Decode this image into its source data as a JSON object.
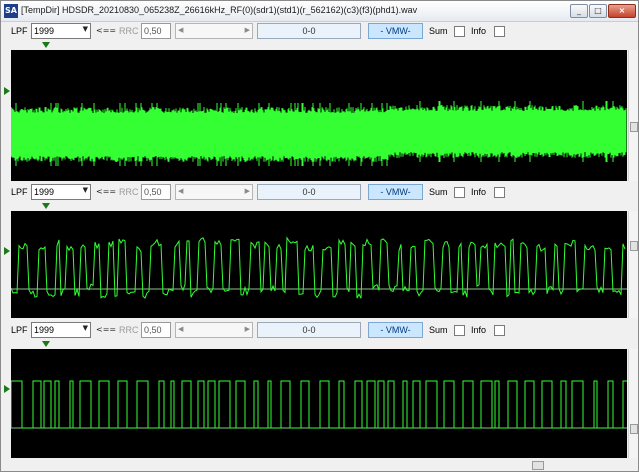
{
  "window": {
    "title": "[TempDir] HDSDR_20210830_065238Z_26616kHz_RF(0)(sdr1)(std1)(r_562162)(c3)(f3)(phd1).wav",
    "app_icon_text": "SA",
    "minimize_glyph": "_",
    "maximize_glyph": "□",
    "close_glyph": "×"
  },
  "panels": [
    {
      "lpf_label": "LPF",
      "lpf_value": "1999",
      "dropdown_glyph": "▼",
      "arrow_label": "<==",
      "rrc_label": "RRC",
      "rrc_value": "0,50",
      "slider_left": "◀",
      "slider_right": "▶",
      "counter": "0-0",
      "vmw_label": "- VMW-",
      "sum_label": "Sum",
      "info_label": "Info"
    },
    {
      "lpf_label": "LPF",
      "lpf_value": "1999",
      "dropdown_glyph": "▼",
      "arrow_label": "<==",
      "rrc_label": "RRC",
      "rrc_value": "0,50",
      "slider_left": "◀",
      "slider_right": "▶",
      "counter": "0-0",
      "vmw_label": "- VMW-",
      "sum_label": "Sum",
      "info_label": "Info"
    },
    {
      "lpf_label": "LPF",
      "lpf_value": "1999",
      "dropdown_glyph": "▼",
      "arrow_label": "<==",
      "rrc_label": "RRC",
      "rrc_value": "0,50",
      "slider_left": "◀",
      "slider_right": "▶",
      "counter": "0-0",
      "vmw_label": "- VMW-",
      "sum_label": "Sum",
      "info_label": "Info"
    }
  ],
  "colors": {
    "trace": "#33ff33",
    "scope_bg": "#000000",
    "baseline": "#8fbf8f",
    "vmw_bg": "#cbe7ff"
  }
}
